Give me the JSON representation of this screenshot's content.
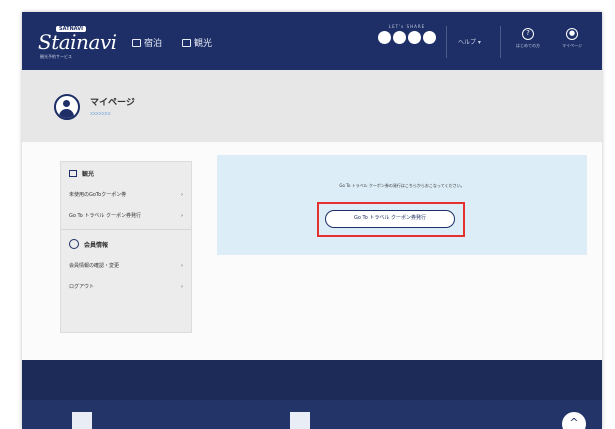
{
  "header": {
    "logo_badge": "SATNAVI",
    "logo_text": "Stainavi",
    "logo_sub": "観光予約サービス",
    "nav": [
      {
        "label": "宿泊",
        "icon": "calendar-icon"
      },
      {
        "label": "観光",
        "icon": "building-icon"
      }
    ],
    "share_label": "LET's SHARE",
    "help_label": "ヘルプ ▾",
    "actions": [
      {
        "label": "はじめての方",
        "icon": "question-icon",
        "glyph": "?"
      },
      {
        "label": "マイページ",
        "icon": "user-icon",
        "glyph": "●"
      }
    ]
  },
  "profile": {
    "title": "マイページ",
    "username": "xxxxxxx"
  },
  "sidebar": {
    "section1": {
      "title": "観光",
      "icon": "building-icon"
    },
    "section1_items": [
      {
        "label": "未使用のGoToクーポン券"
      },
      {
        "label": "Go To トラベル クーポン券発行"
      }
    ],
    "section2": {
      "title": "会員情報",
      "icon": "user-circle-icon"
    },
    "section2_items": [
      {
        "label": "会員情報の確認・変更"
      },
      {
        "label": "ログアウト"
      }
    ],
    "chevron": "›"
  },
  "notice": {
    "text": "Go To トラベル クーポン券の発行はこちらからおこなってください。",
    "button_label": "Go To トラベル クーポン券発行"
  },
  "footer": {
    "scroll_top": "^"
  },
  "colors": {
    "navy": "#1d2f66",
    "highlight": "#e53030",
    "notice_bg": "#dcedf7"
  }
}
